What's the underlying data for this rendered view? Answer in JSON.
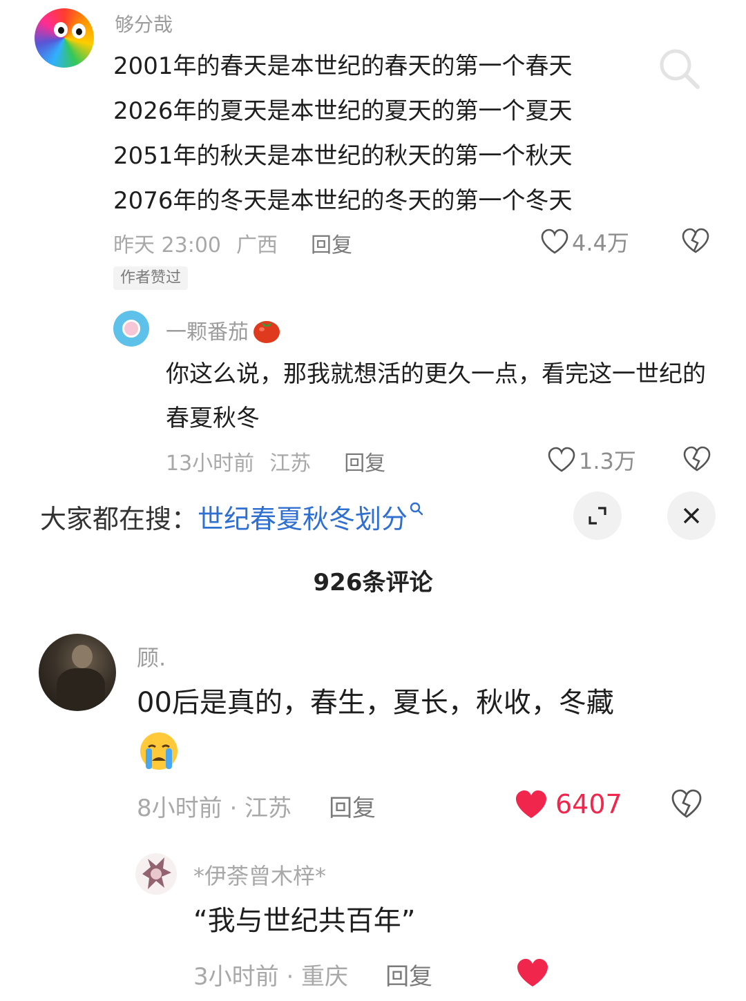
{
  "comment1": {
    "username": "够分哉",
    "lines": [
      "2001年的春天是本世纪的春天的第一个春天",
      "2026年的夏天是本世纪的夏天的第一个夏天",
      "2051年的秋天是本世纪的秋天的第一个秋天",
      "2076年的冬天是本世纪的冬天的第一个冬天"
    ],
    "time": "昨天 23:00",
    "location": "广西",
    "reply_label": "回复",
    "likes": "4.4万",
    "author_badge": "作者赞过"
  },
  "reply1": {
    "username": "一颗番茄",
    "text": "你这么说，那我就想活的更久一点，看完这一世纪的春夏秋冬",
    "time": "13小时前",
    "location": "江苏",
    "reply_label": "回复",
    "likes": "1.3万"
  },
  "search_bar": {
    "prefix": "大家都在搜：",
    "query": "世纪春夏秋冬划分"
  },
  "comment_count": "926条评论",
  "comment2": {
    "username": "顾.",
    "text": "00后是真的，春生，夏长，秋收，冬藏",
    "time": "8小时前 · 江苏",
    "reply_label": "回复",
    "likes": "6407"
  },
  "reply2": {
    "username": "*伊荼曾木梓*",
    "text": "“我与世纪共百年”",
    "time": "3小时前 · 重庆",
    "reply_label": "回复"
  },
  "colors": {
    "liked_red": "#f0264c",
    "link_blue": "#2f6fd0",
    "muted_gray": "#a8a8a8"
  },
  "icons": [
    "search-icon",
    "heart-icon",
    "dislike-heart-icon",
    "expand-icon",
    "close-icon",
    "crying-emoji-icon",
    "tomato-emoji-icon"
  ]
}
